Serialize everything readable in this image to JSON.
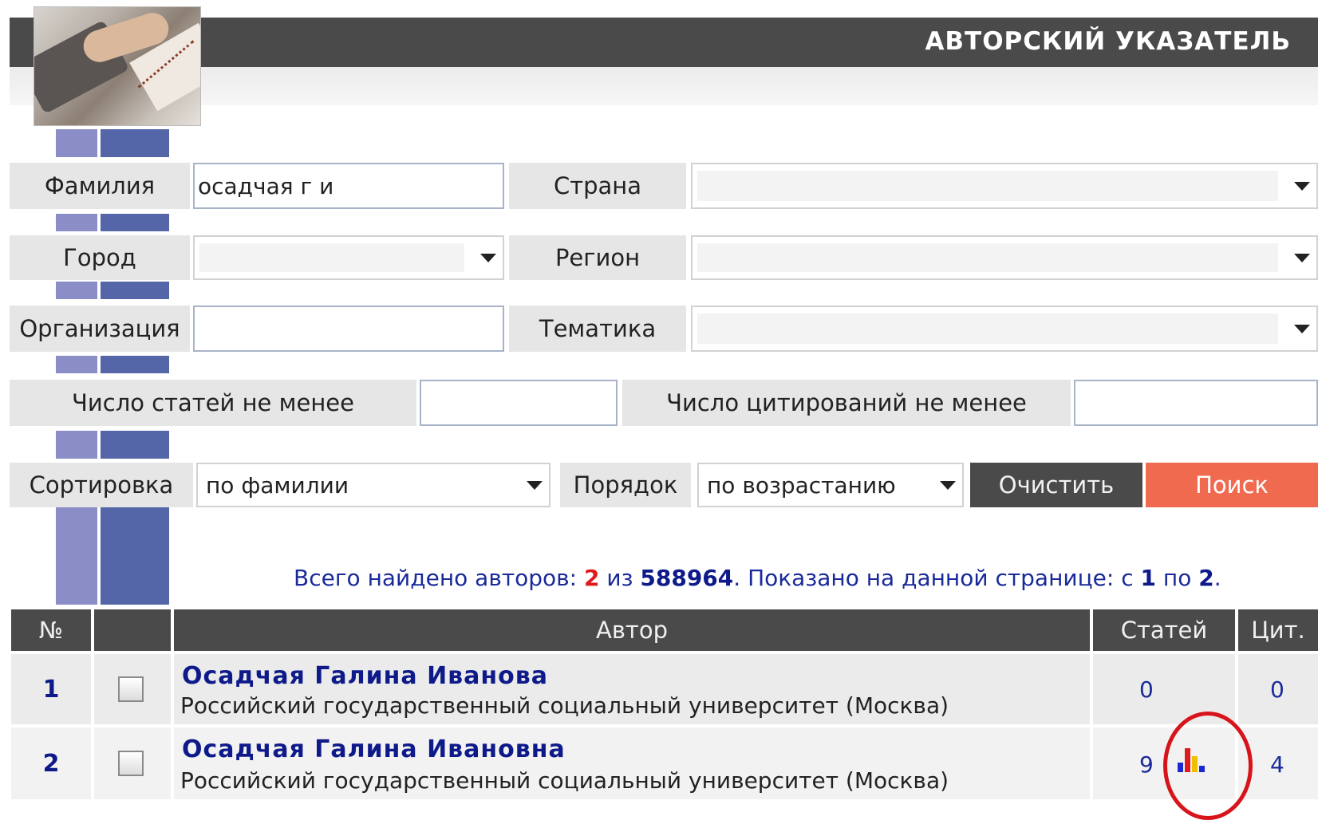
{
  "header": {
    "title": "АВТОРСКИЙ УКАЗАТЕЛЬ"
  },
  "form": {
    "surname": {
      "label": "Фамилия",
      "value": "осадчая г и"
    },
    "country": {
      "label": "Страна",
      "value": ""
    },
    "city": {
      "label": "Город",
      "value": ""
    },
    "region": {
      "label": "Регион",
      "value": ""
    },
    "organization": {
      "label": "Организация",
      "value": ""
    },
    "topic": {
      "label": "Тематика",
      "value": ""
    },
    "min_articles": {
      "label": "Число статей не менее",
      "value": ""
    },
    "min_citations": {
      "label": "Число цитирований не менее",
      "value": ""
    },
    "sort": {
      "label": "Сортировка",
      "value": "по фамилии"
    },
    "order": {
      "label": "Порядок",
      "value": "по возрастанию"
    },
    "clear_label": "Очистить",
    "search_label": "Поиск"
  },
  "summary": {
    "found_prefix": "Всего найдено авторов: ",
    "found_count": "2",
    "of_word": " из ",
    "total": "588964",
    "shown_prefix": ".   Показано на данной странице: с ",
    "from": "1",
    "to_word": " по ",
    "to": "2",
    "suffix": "."
  },
  "table": {
    "headers": {
      "num": "№",
      "author": "Автор",
      "articles": "Статей",
      "citations": "Цит."
    },
    "rows": [
      {
        "num": "1",
        "name": "Осадчая  Галина  Иванова",
        "org": "Российский государственный социальный университет (Москва)",
        "articles": "0",
        "citations": "0"
      },
      {
        "num": "2",
        "name": "Осадчая  Галина  Ивановна",
        "org": "Российский государственный социальный университет (Москва)",
        "articles": "9",
        "citations": "4"
      }
    ]
  },
  "icons": {
    "stats": "bar-chart-icon",
    "dropdown": "chevron-down-icon"
  },
  "colors": {
    "header_bg": "#4a4a4a",
    "search_button": "#f06a50",
    "link_blue": "#0e1a8a",
    "highlight_ring": "#d8141b"
  }
}
